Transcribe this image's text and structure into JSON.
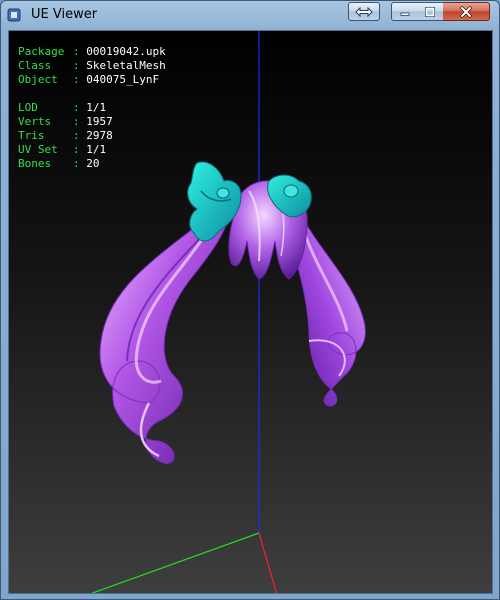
{
  "window": {
    "title": "UE Viewer",
    "controls": {
      "swap_icon": "swap-arrows-icon",
      "minimize_icon": "minimize-icon",
      "maximize_icon": "maximize-icon",
      "close_icon": "close-icon"
    },
    "colors": {
      "close_button": "#c0452c",
      "titlebar": "#a9c6e2"
    }
  },
  "info": {
    "label_color": "#2ee04a",
    "value_color": "#ffffff",
    "separator": ":",
    "package_label": "Package",
    "package_value": "00019042.upk",
    "class_label": "Class",
    "class_value": "SkeletalMesh",
    "object_label": "Object",
    "object_value": "040075_LynF",
    "lod_label": "LOD",
    "lod_value": "1/1",
    "verts_label": "Verts",
    "verts_value": "1957",
    "tris_label": "Tris",
    "tris_value": "2978",
    "uvset_label": "UV Set",
    "uvset_value": "1/1",
    "bones_label": "Bones",
    "bones_value": "20"
  },
  "scene": {
    "model": "pigtail-hair-mesh",
    "axes": {
      "x_color": "#ff2020",
      "y_color": "#20e020",
      "z_color": "#2020ff"
    },
    "mesh_colors": {
      "hair": "#c070f0",
      "ribbon": "#20c8c8"
    }
  }
}
